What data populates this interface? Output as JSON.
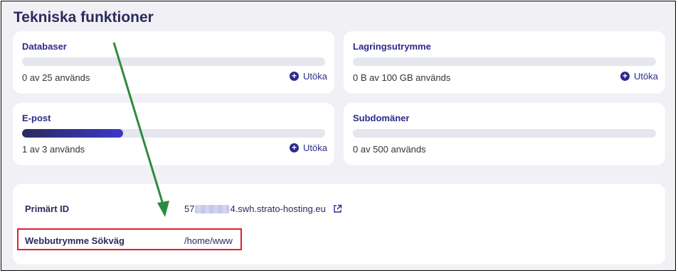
{
  "page": {
    "title": "Tekniska funktioner"
  },
  "features": {
    "databases": {
      "title": "Databaser",
      "usage": "0 av 25 används",
      "used": 0,
      "total": 25,
      "expand_label": "Utöka"
    },
    "storage": {
      "title": "Lagringsutrymme",
      "usage": "0 B av 100 GB används",
      "used_fraction": 0,
      "expand_label": "Utöka"
    },
    "email": {
      "title": "E-post",
      "usage": "1 av 3 används",
      "used": 1,
      "total": 3,
      "expand_label": "Utöka"
    },
    "subdomains": {
      "title": "Subdomäner",
      "usage": "0 av 500 används",
      "used": 0,
      "total": 500
    }
  },
  "details": {
    "primary_id": {
      "label": "Primärt ID",
      "value_prefix": "57",
      "value_suffix": "4.swh.strato-hosting.eu"
    },
    "webspace_path": {
      "label": "Webbutrymme Sökväg",
      "value": "/home/www"
    }
  },
  "icons": {
    "expand": "plus-circle-icon",
    "external_link": "external-link-icon"
  },
  "colors": {
    "accent": "#2d2a8c",
    "title": "#2b2a5e",
    "background": "#f0f0f5",
    "bar_track": "#e5e6ee",
    "annotation_arrow": "#2e8b3e",
    "annotation_box": "#e2202f"
  }
}
